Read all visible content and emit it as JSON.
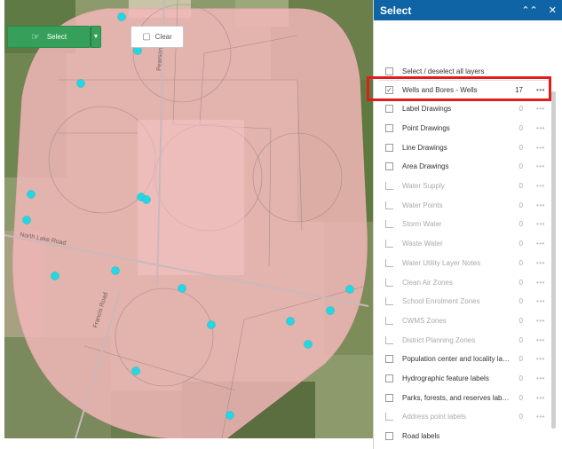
{
  "panel": {
    "title": "Select",
    "icons": {
      "collapse": "double-chevron-up-icon",
      "close": "close-icon"
    },
    "select_button": {
      "label": "Select",
      "icon": "select-cursor-icon"
    },
    "clear_button": {
      "label": "Clear",
      "icon": "clear-selection-icon"
    },
    "select_all_label": "Select / deselect all layers"
  },
  "layers": [
    {
      "label": "Wells and Bores - Wells",
      "count": "17",
      "checked": true,
      "enabled": true
    },
    {
      "label": "Label Drawings",
      "count": "0",
      "checked": false,
      "enabled": true
    },
    {
      "label": "Point Drawings",
      "count": "0",
      "checked": false,
      "enabled": true
    },
    {
      "label": "Line Drawings",
      "count": "0",
      "checked": false,
      "enabled": true
    },
    {
      "label": "Area Drawings",
      "count": "0",
      "checked": false,
      "enabled": true
    },
    {
      "label": "Water Supply",
      "count": "0",
      "checked": false,
      "enabled": false
    },
    {
      "label": "Water Points",
      "count": "0",
      "checked": false,
      "enabled": false
    },
    {
      "label": "Storm Water",
      "count": "0",
      "checked": false,
      "enabled": false
    },
    {
      "label": "Waste Water",
      "count": "0",
      "checked": false,
      "enabled": false
    },
    {
      "label": "Water Utility Layer Notes",
      "count": "0",
      "checked": false,
      "enabled": false
    },
    {
      "label": "Clean Air Zones",
      "count": "0",
      "checked": false,
      "enabled": false
    },
    {
      "label": "School Enrolment Zones",
      "count": "0",
      "checked": false,
      "enabled": false
    },
    {
      "label": "CWMS Zones",
      "count": "0",
      "checked": false,
      "enabled": false
    },
    {
      "label": "District Planning Zones",
      "count": "0",
      "checked": false,
      "enabled": false
    },
    {
      "label": "Population center and locality lab...",
      "count": "0",
      "checked": false,
      "enabled": true
    },
    {
      "label": "Hydrographic feature labels",
      "count": "0",
      "checked": false,
      "enabled": true
    },
    {
      "label": "Parks, forests, and reserves labels",
      "count": "0",
      "checked": false,
      "enabled": true
    },
    {
      "label": "Address point labels",
      "count": "0",
      "checked": false,
      "enabled": false
    },
    {
      "label": "Road labels",
      "count": "",
      "checked": false,
      "enabled": true
    }
  ],
  "map": {
    "road_labels": [
      "North Lake Road",
      "Pearson Road",
      "Francis Road"
    ],
    "buffer_fill": "#f7b8bc",
    "point_color": "#22d8e6"
  },
  "colors": {
    "header": "#0f64a6",
    "select_button": "#36a05a",
    "highlight": "#e01d1d"
  }
}
